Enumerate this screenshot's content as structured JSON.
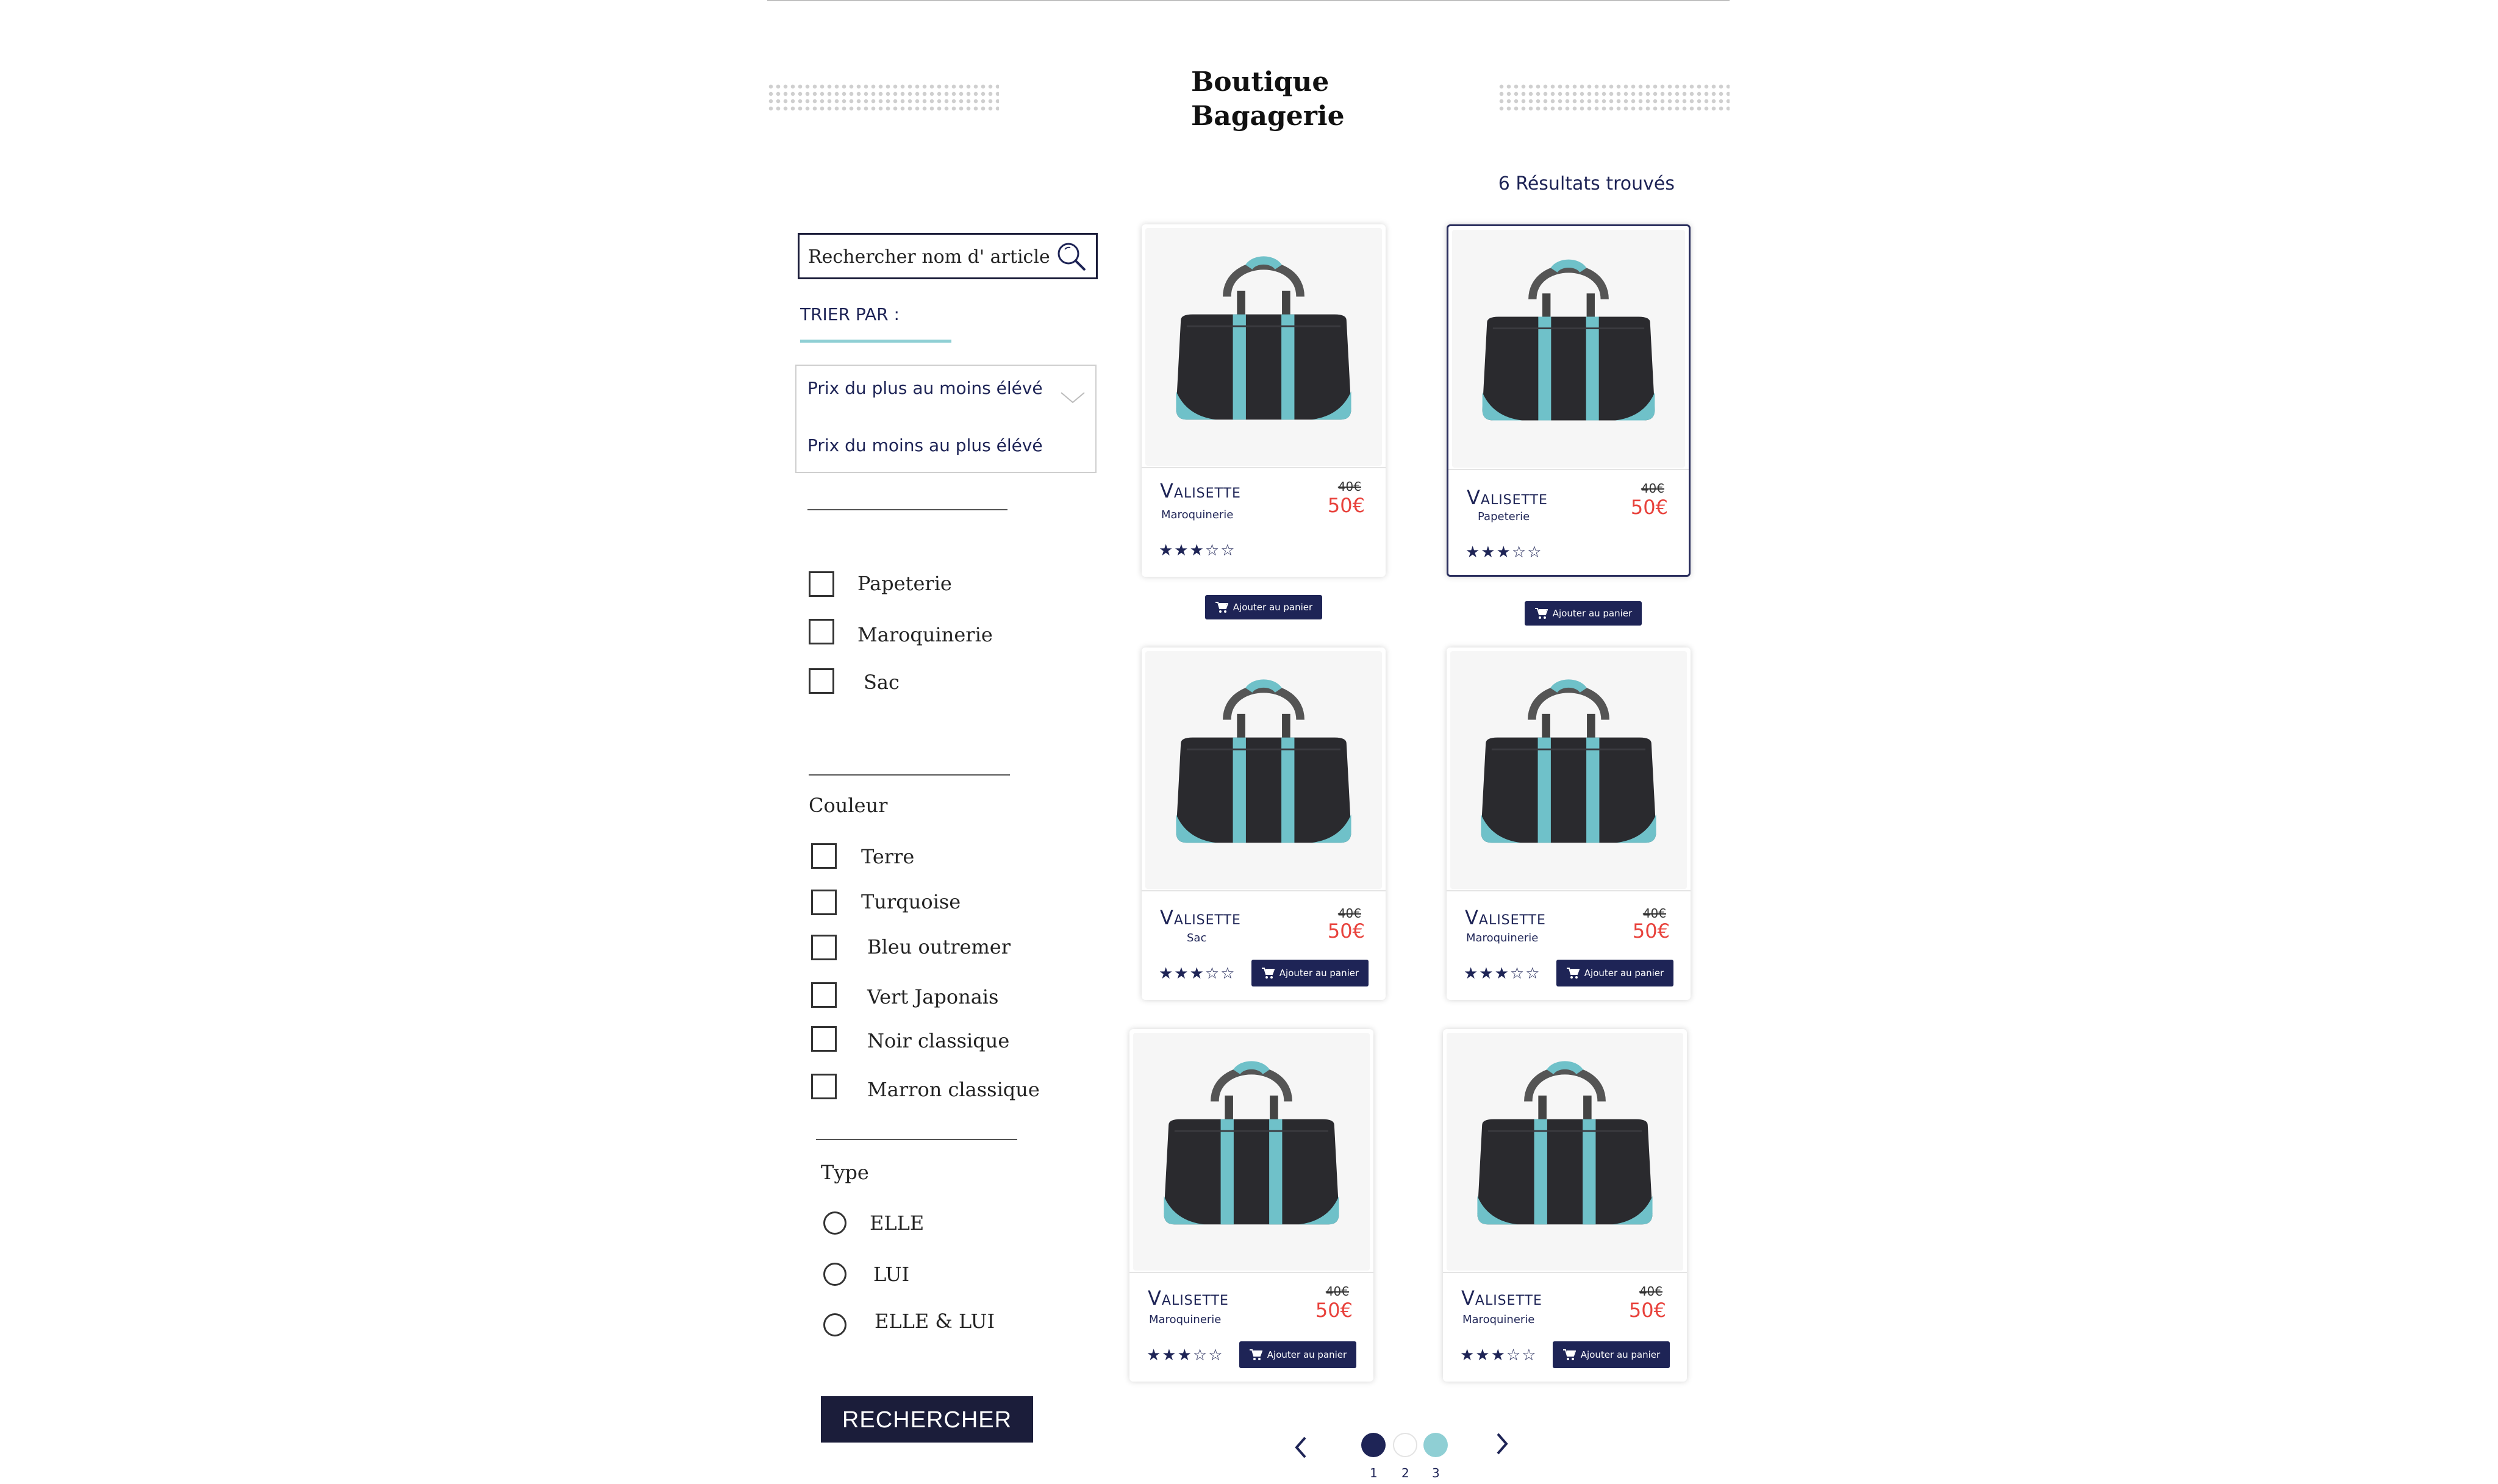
{
  "header": {
    "title": "Boutique Bagagerie"
  },
  "results_text": "6 Résultats trouvés",
  "search": {
    "placeholder": "Rechercher nom d' article ..."
  },
  "sort": {
    "label": "TRIER PAR :",
    "options": [
      "Prix du plus au moins élévé",
      "Prix du moins au plus élévé"
    ]
  },
  "categories": [
    "Papeterie",
    "Maroquinerie",
    "Sac"
  ],
  "colors": {
    "heading": "Couleur",
    "items": [
      "Terre",
      "Turquoise",
      "Bleu outremer",
      "Vert Japonais",
      "Noir classique",
      "Marron classique"
    ]
  },
  "type": {
    "heading": "Type",
    "items": [
      "ELLE",
      "LUI",
      "ELLE & LUI"
    ]
  },
  "search_button": "RECHERCHER",
  "cart_label": "Ajouter au panier",
  "products": [
    {
      "name": "Valisette",
      "category": "Maroquinerie",
      "old_price": "40€",
      "price": "50€",
      "rating": 3,
      "max_rating": 5
    },
    {
      "name": "Valisette",
      "category": "Papeterie",
      "old_price": "40€",
      "price": "50€",
      "rating": 3,
      "max_rating": 5
    },
    {
      "name": "Valisette",
      "category": "Sac",
      "old_price": "40€",
      "price": "50€",
      "rating": 3,
      "max_rating": 5
    },
    {
      "name": "Valisette",
      "category": "Maroquinerie",
      "old_price": "40€",
      "price": "50€",
      "rating": 3,
      "max_rating": 5
    },
    {
      "name": "Valisette",
      "category": "Maroquinerie",
      "old_price": "40€",
      "price": "50€",
      "rating": 3,
      "max_rating": 5
    },
    {
      "name": "Valisette",
      "category": "Maroquinerie",
      "old_price": "40€",
      "price": "50€",
      "rating": 3,
      "max_rating": 5
    }
  ],
  "pagination": {
    "pages": [
      "1",
      "2",
      "3"
    ],
    "current": 1
  },
  "palette": {
    "navy": "#1e2456",
    "price_red": "#e8423c",
    "turquoise": "#8fcfd4",
    "dark": "#1b1d3a"
  },
  "icons": {
    "search": "search-icon",
    "cart": "cart-icon",
    "chevron": "chevron-down-icon",
    "prev": "chevron-left-icon",
    "next": "chevron-right-icon"
  }
}
